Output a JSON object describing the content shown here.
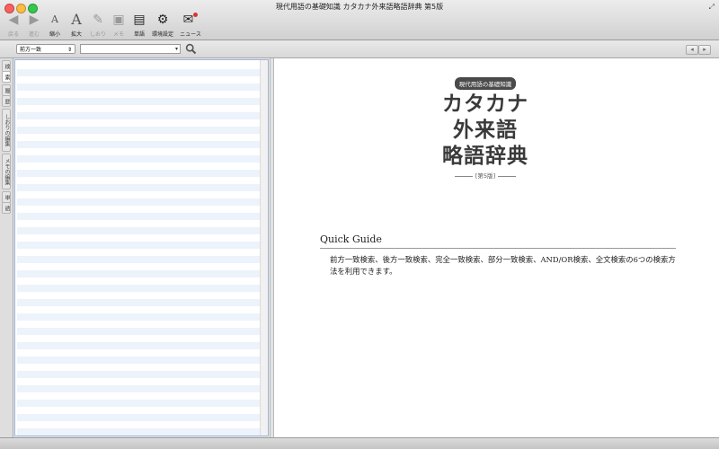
{
  "window": {
    "title": "現代用語の基礎知識 カタカナ外来語略語辞典 第5版"
  },
  "toolbar": {
    "items": [
      {
        "label": "戻る",
        "icon": "back-arrow-icon",
        "disabled": true
      },
      {
        "label": "進む",
        "icon": "forward-arrow-icon",
        "disabled": true
      },
      {
        "label": "縮小",
        "icon": "font-smaller-icon",
        "disabled": false
      },
      {
        "label": "拡大",
        "icon": "font-larger-icon",
        "disabled": false
      },
      {
        "label": "しおり",
        "icon": "bookmark-icon",
        "disabled": true
      },
      {
        "label": "メモ",
        "icon": "memo-icon",
        "disabled": true
      },
      {
        "label": "単語",
        "icon": "wordbook-icon",
        "disabled": false
      },
      {
        "label": "環境設定",
        "icon": "gear-icon",
        "disabled": false
      },
      {
        "label": "ニュース",
        "icon": "news-icon",
        "disabled": false
      }
    ]
  },
  "search": {
    "mode_value": "前方一致",
    "query_value": ""
  },
  "sidetabs": [
    {
      "label": "検",
      "active": false
    },
    {
      "label": "索",
      "active": true
    },
    {
      "label": "履",
      "active": false
    },
    {
      "label": "歴",
      "active": false
    },
    {
      "label": "しおりの編集",
      "active": false
    },
    {
      "label": "メモの編集",
      "active": false
    },
    {
      "label": "単",
      "active": false
    },
    {
      "label": "語",
      "active": false
    }
  ],
  "content": {
    "cover": {
      "series": "現代用語の基礎知識",
      "title_lines": [
        "カタカナ",
        "外来語",
        "略語辞典"
      ],
      "edition": "第5版"
    },
    "quick_guide": {
      "heading": "Quick Guide",
      "body": "前方一致検索、後方一致検索、完全一致検索、部分一致検索、AND/OR検索、全文検索の6つの検索方法を利用できます。"
    }
  },
  "colors": {
    "selection_border": "#9ab3d5",
    "row_stripe": "#edf3fb"
  }
}
